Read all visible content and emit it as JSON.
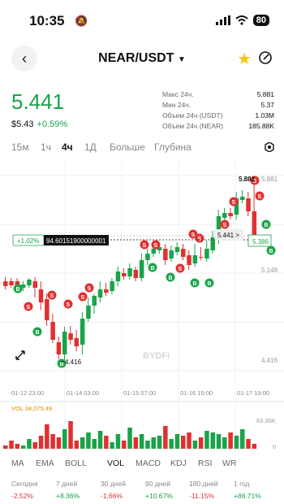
{
  "status": {
    "time": "10:35",
    "battery": "80"
  },
  "header": {
    "pair": "NEAR/USDT",
    "dropdown": "▼"
  },
  "price": {
    "last": "5.441",
    "fiat": "$5.43",
    "change": "+0.59%"
  },
  "stats": [
    {
      "label": "Макс 24ч.",
      "value": "5.881"
    },
    {
      "label": "Мин 24ч.",
      "value": "5.37"
    },
    {
      "label": "Объем 24ч (USDT)",
      "value": "1.03M"
    },
    {
      "label": "Объем 24ч (NEAR)",
      "value": "185.88K"
    }
  ],
  "tabs": [
    "15м",
    "1ч",
    "4ч",
    "1Д",
    "Больше",
    "Глубина"
  ],
  "active_tab": "4ч",
  "chart": {
    "price_labels": [
      "5.881",
      "5.386",
      "5.148",
      "4.416"
    ],
    "high_label": "5.881",
    "low_label": "4.416",
    "current_price": "5.441",
    "current_tag": "5.441 >",
    "cursor_value": "94.60151900000001",
    "cursor_pct": "+1.02%",
    "dates": [
      "01-12 23:00",
      "01-14 03:00",
      "01-15 07:00",
      "01-16 15:00",
      "01-17 19:00"
    ],
    "vol_label": "VOL 34,075.49",
    "vol_max": "63.35K",
    "vol_zero": "0",
    "watermark": "BYDFi",
    "up_color": "#1aa34a",
    "down_color": "#e03030"
  },
  "indicators": [
    "MA",
    "EMA",
    "BOLL",
    "VOL",
    "MACD",
    "KDJ",
    "RSI",
    "WR"
  ],
  "active_indicator": "VOL",
  "performance": [
    {
      "label": "Сегодня",
      "value": "-2.52%"
    },
    {
      "label": "7 дней",
      "value": "+8.36%"
    },
    {
      "label": "30 дней",
      "value": "-1.66%"
    },
    {
      "label": "90 дней",
      "value": "+10.67%"
    },
    {
      "label": "180 дней",
      "value": "-11.15%"
    },
    {
      "label": "1 год",
      "value": "+86.71%"
    }
  ]
}
